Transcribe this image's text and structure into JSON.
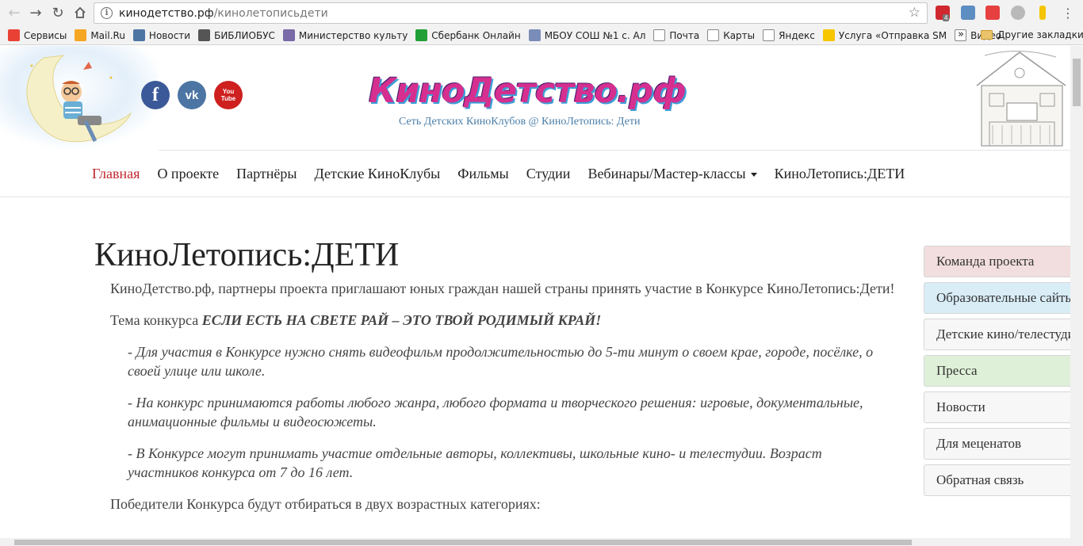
{
  "browser": {
    "url_host": "кинодетство.рф",
    "url_path": "/кинолетописьдети",
    "ext_badge": "4"
  },
  "bookmarks": {
    "items": [
      {
        "label": "Сервисы",
        "icon": "apps-grid-icon",
        "color": "#e94235"
      },
      {
        "label": "Mail.Ru",
        "icon": "mailru-icon",
        "color": "#f5a623"
      },
      {
        "label": "Новости",
        "icon": "vk-icon",
        "color": "#4c75a3"
      },
      {
        "label": "БИБЛИОБУС",
        "icon": "gear-icon",
        "color": "#555555"
      },
      {
        "label": "Министерство культу",
        "icon": "emblem-icon",
        "color": "#7a6aa8"
      },
      {
        "label": "Сбербанк Онлайн",
        "icon": "sberbank-icon",
        "color": "#21a038"
      },
      {
        "label": "МБОУ СОШ №1 с. Ал",
        "icon": "shield-icon",
        "color": "#7a8db8"
      },
      {
        "label": "Почта",
        "icon": "page-icon",
        "color": "#ffffff"
      },
      {
        "label": "Карты",
        "icon": "page-icon",
        "color": "#ffffff"
      },
      {
        "label": "Яндекс",
        "icon": "page-icon",
        "color": "#ffffff"
      },
      {
        "label": "Услуга «Отправка SM",
        "icon": "beeline-icon",
        "color": "#f7c600"
      },
      {
        "label": "Видео",
        "icon": "page-icon",
        "color": "#ffffff"
      }
    ],
    "more": "»",
    "other": "Другие закладки"
  },
  "header": {
    "logo_text": "КиноДетство.рф",
    "tagline": "Сеть Детских КиноКлубов @ КиноЛетопись: Дети",
    "social": [
      {
        "name": "facebook-icon",
        "glyph": "f"
      },
      {
        "name": "vk-icon",
        "glyph": "vk"
      },
      {
        "name": "youtube-icon",
        "glyph": "You Tube"
      }
    ]
  },
  "nav": {
    "items": [
      {
        "label": "Главная",
        "active": true
      },
      {
        "label": "О проекте"
      },
      {
        "label": "Партнёры"
      },
      {
        "label": "Детские КиноКлубы"
      },
      {
        "label": "Фильмы"
      },
      {
        "label": "Студии"
      },
      {
        "label": "Вебинары/Мастер-классы",
        "dropdown": true
      },
      {
        "label": "КиноЛетопись:ДЕТИ"
      }
    ]
  },
  "content": {
    "title": "КиноЛетопись:ДЕТИ",
    "intro": "КиноДетство.рф, партнеры проекта приглашают юных граждан нашей страны принять участие в Конкурсе КиноЛетопись:Дети!",
    "theme_prefix": "Тема конкурса ",
    "theme_bold": "ЕСЛИ ЕСТЬ НА СВЕТЕ РАЙ – ЭТО ТВОЙ РОДИМЫЙ КРАЙ!",
    "rules": [
      "- Для участия в Конкурсе нужно   снять видеофильм продолжительностью до 5-ти минут о своем крае, городе, посёлке, о своей улице или школе.",
      "- На конкурс принимаются работы любого жанра, любого формата и творческого решения: игровые, документальные, анимационные фильмы и видеосюжеты.",
      "- В Конкурсе могут принимать участие отдельные авторы, коллективы, школьные кино- и телестудии. Возраст участников конкурса от 7 до 16 лет."
    ],
    "categories": "Победители Конкурса будут отбираться в двух возрастных категориях:"
  },
  "sidebar": {
    "items": [
      {
        "label": "Команда проекта",
        "bg": "#f2dede"
      },
      {
        "label": "Образовательные сайты",
        "bg": "#d9edf7"
      },
      {
        "label": "Детские кино/телестудии",
        "bg": "#f7f7f7"
      },
      {
        "label": "Пресса",
        "bg": "#dff0d8"
      },
      {
        "label": "Новости",
        "bg": "#f7f7f7"
      },
      {
        "label": "Для меценатов",
        "bg": "#f7f7f7"
      },
      {
        "label": "Обратная связь",
        "bg": "#f7f7f7"
      }
    ]
  }
}
